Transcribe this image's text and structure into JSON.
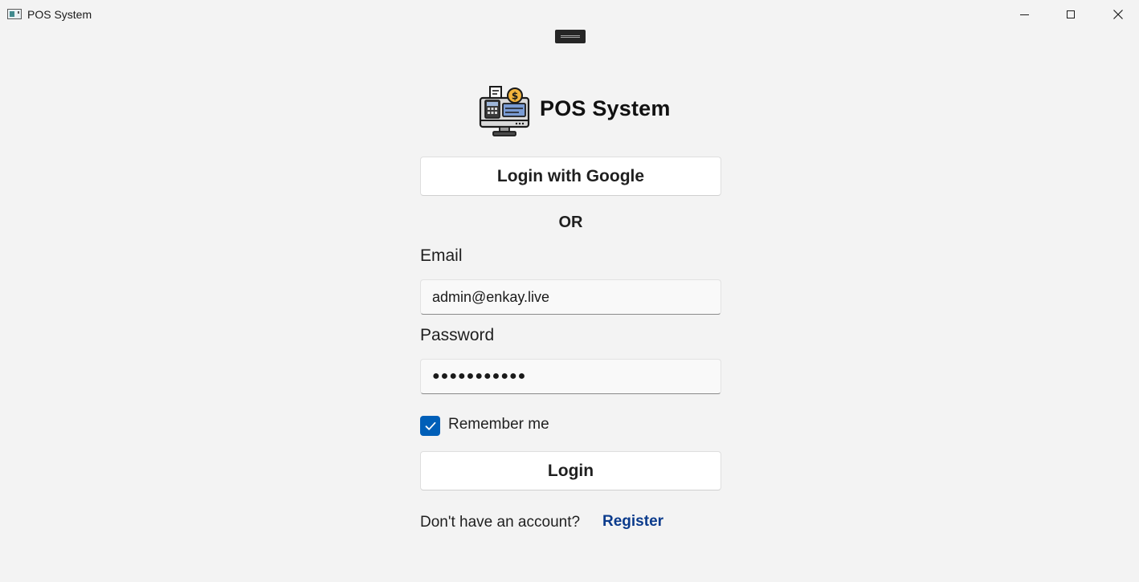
{
  "window": {
    "title": "POS System"
  },
  "brand": {
    "title": "POS System"
  },
  "login_google": {
    "label": "Login with Google"
  },
  "divider": {
    "text": "OR"
  },
  "email": {
    "label": "Email",
    "value": "admin@enkay.live"
  },
  "password": {
    "label": "Password",
    "value": "●●●●●●●●●●●"
  },
  "remember": {
    "label": "Remember me",
    "checked": true
  },
  "login": {
    "label": "Login"
  },
  "footer": {
    "prompt": "Don't have an account?",
    "register_label": "Register"
  },
  "colors": {
    "accent": "#005fb8",
    "link": "#0b3b8c",
    "background": "#f3f3f3"
  },
  "icons": {
    "app": "app-window-icon",
    "logo": "cash-register-icon",
    "minimize": "minimize-icon",
    "maximize": "maximize-icon",
    "close": "close-icon",
    "check": "checkmark-icon"
  }
}
